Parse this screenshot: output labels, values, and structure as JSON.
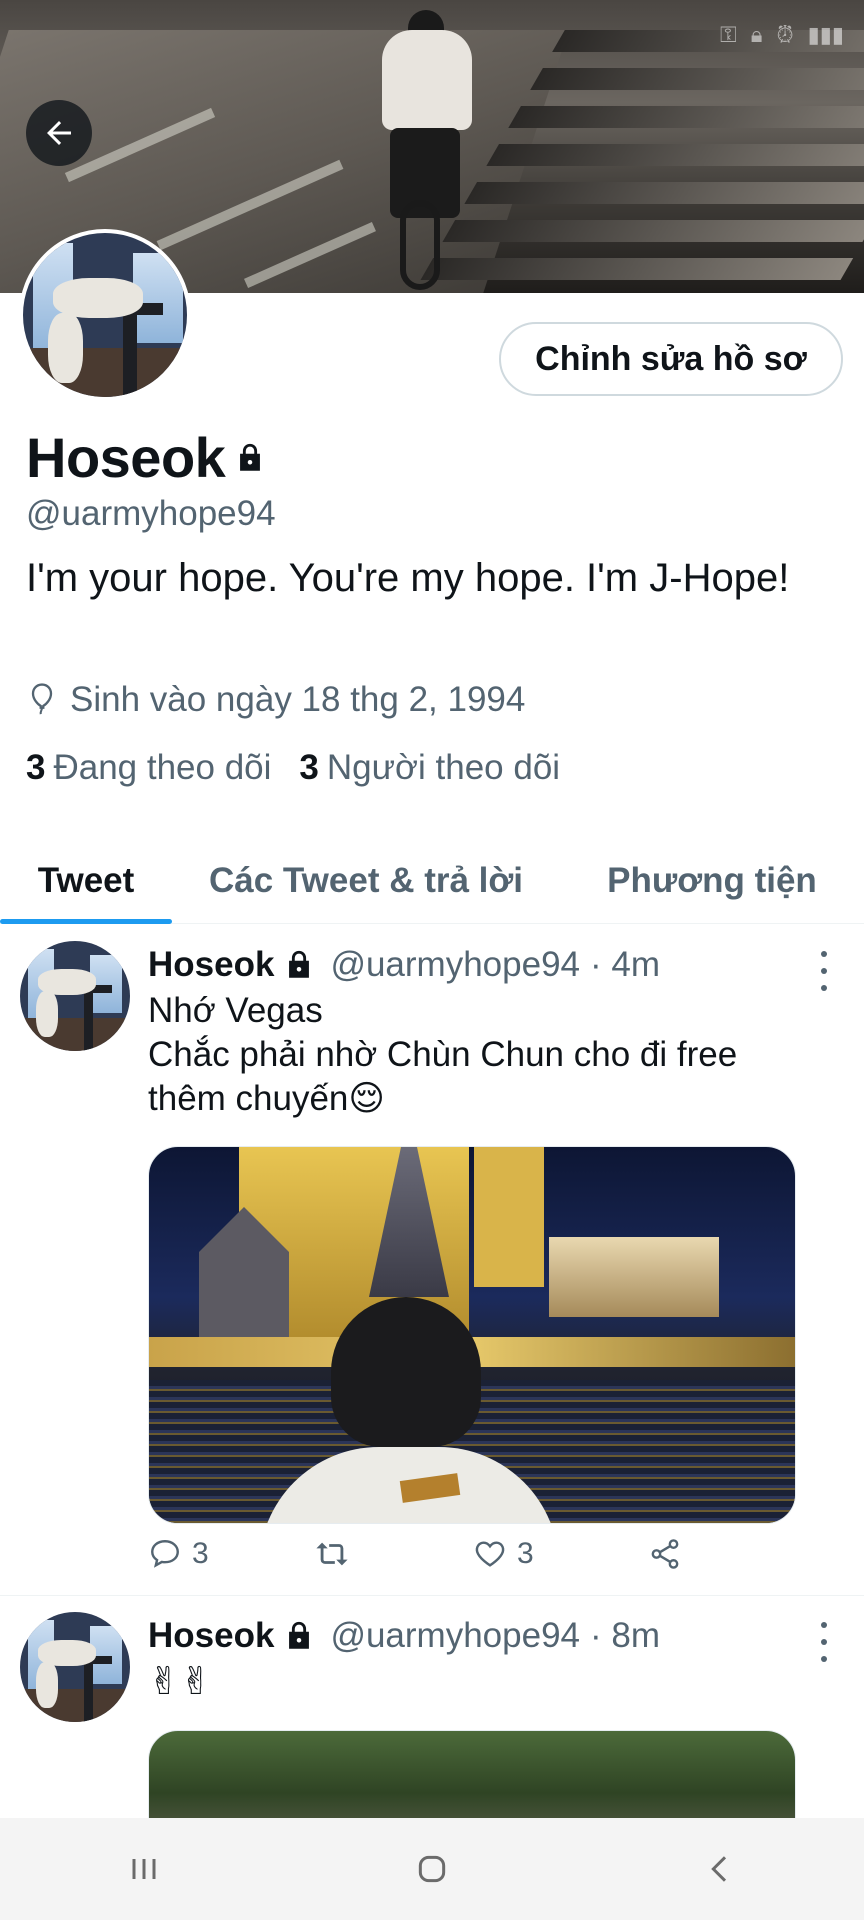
{
  "profile": {
    "name": "Hoseok",
    "handle": "@uarmyhope94",
    "bio": "I'm your hope. You're my hope. I'm J-Hope!",
    "birth": "Sinh vào ngày 18 thg 2, 1994",
    "following_count": "3",
    "following_label": "Đang theo dõi",
    "followers_count": "3",
    "followers_label": "Người theo dõi",
    "edit_label": "Chỉnh sửa hồ sơ"
  },
  "tabs": [
    {
      "label": "Tweet",
      "active": true
    },
    {
      "label": "Các Tweet & trả lời",
      "active": false
    },
    {
      "label": "Phương tiện",
      "active": false
    }
  ],
  "tweets": [
    {
      "name": "Hoseok",
      "handle": "@uarmyhope94",
      "time": "· 4m",
      "line1": "Nhớ Vegas",
      "line2": "Chắc phải nhờ Chùn Chun cho đi free thêm chuyến😌",
      "replies": "3",
      "likes": "3"
    },
    {
      "name": "Hoseok",
      "handle": "@uarmyhope94",
      "time": "· 8m",
      "line1": "✌✌"
    }
  ],
  "colors": {
    "accent": "#1d9bf0",
    "text": "#0f1419",
    "muted": "#536471"
  }
}
